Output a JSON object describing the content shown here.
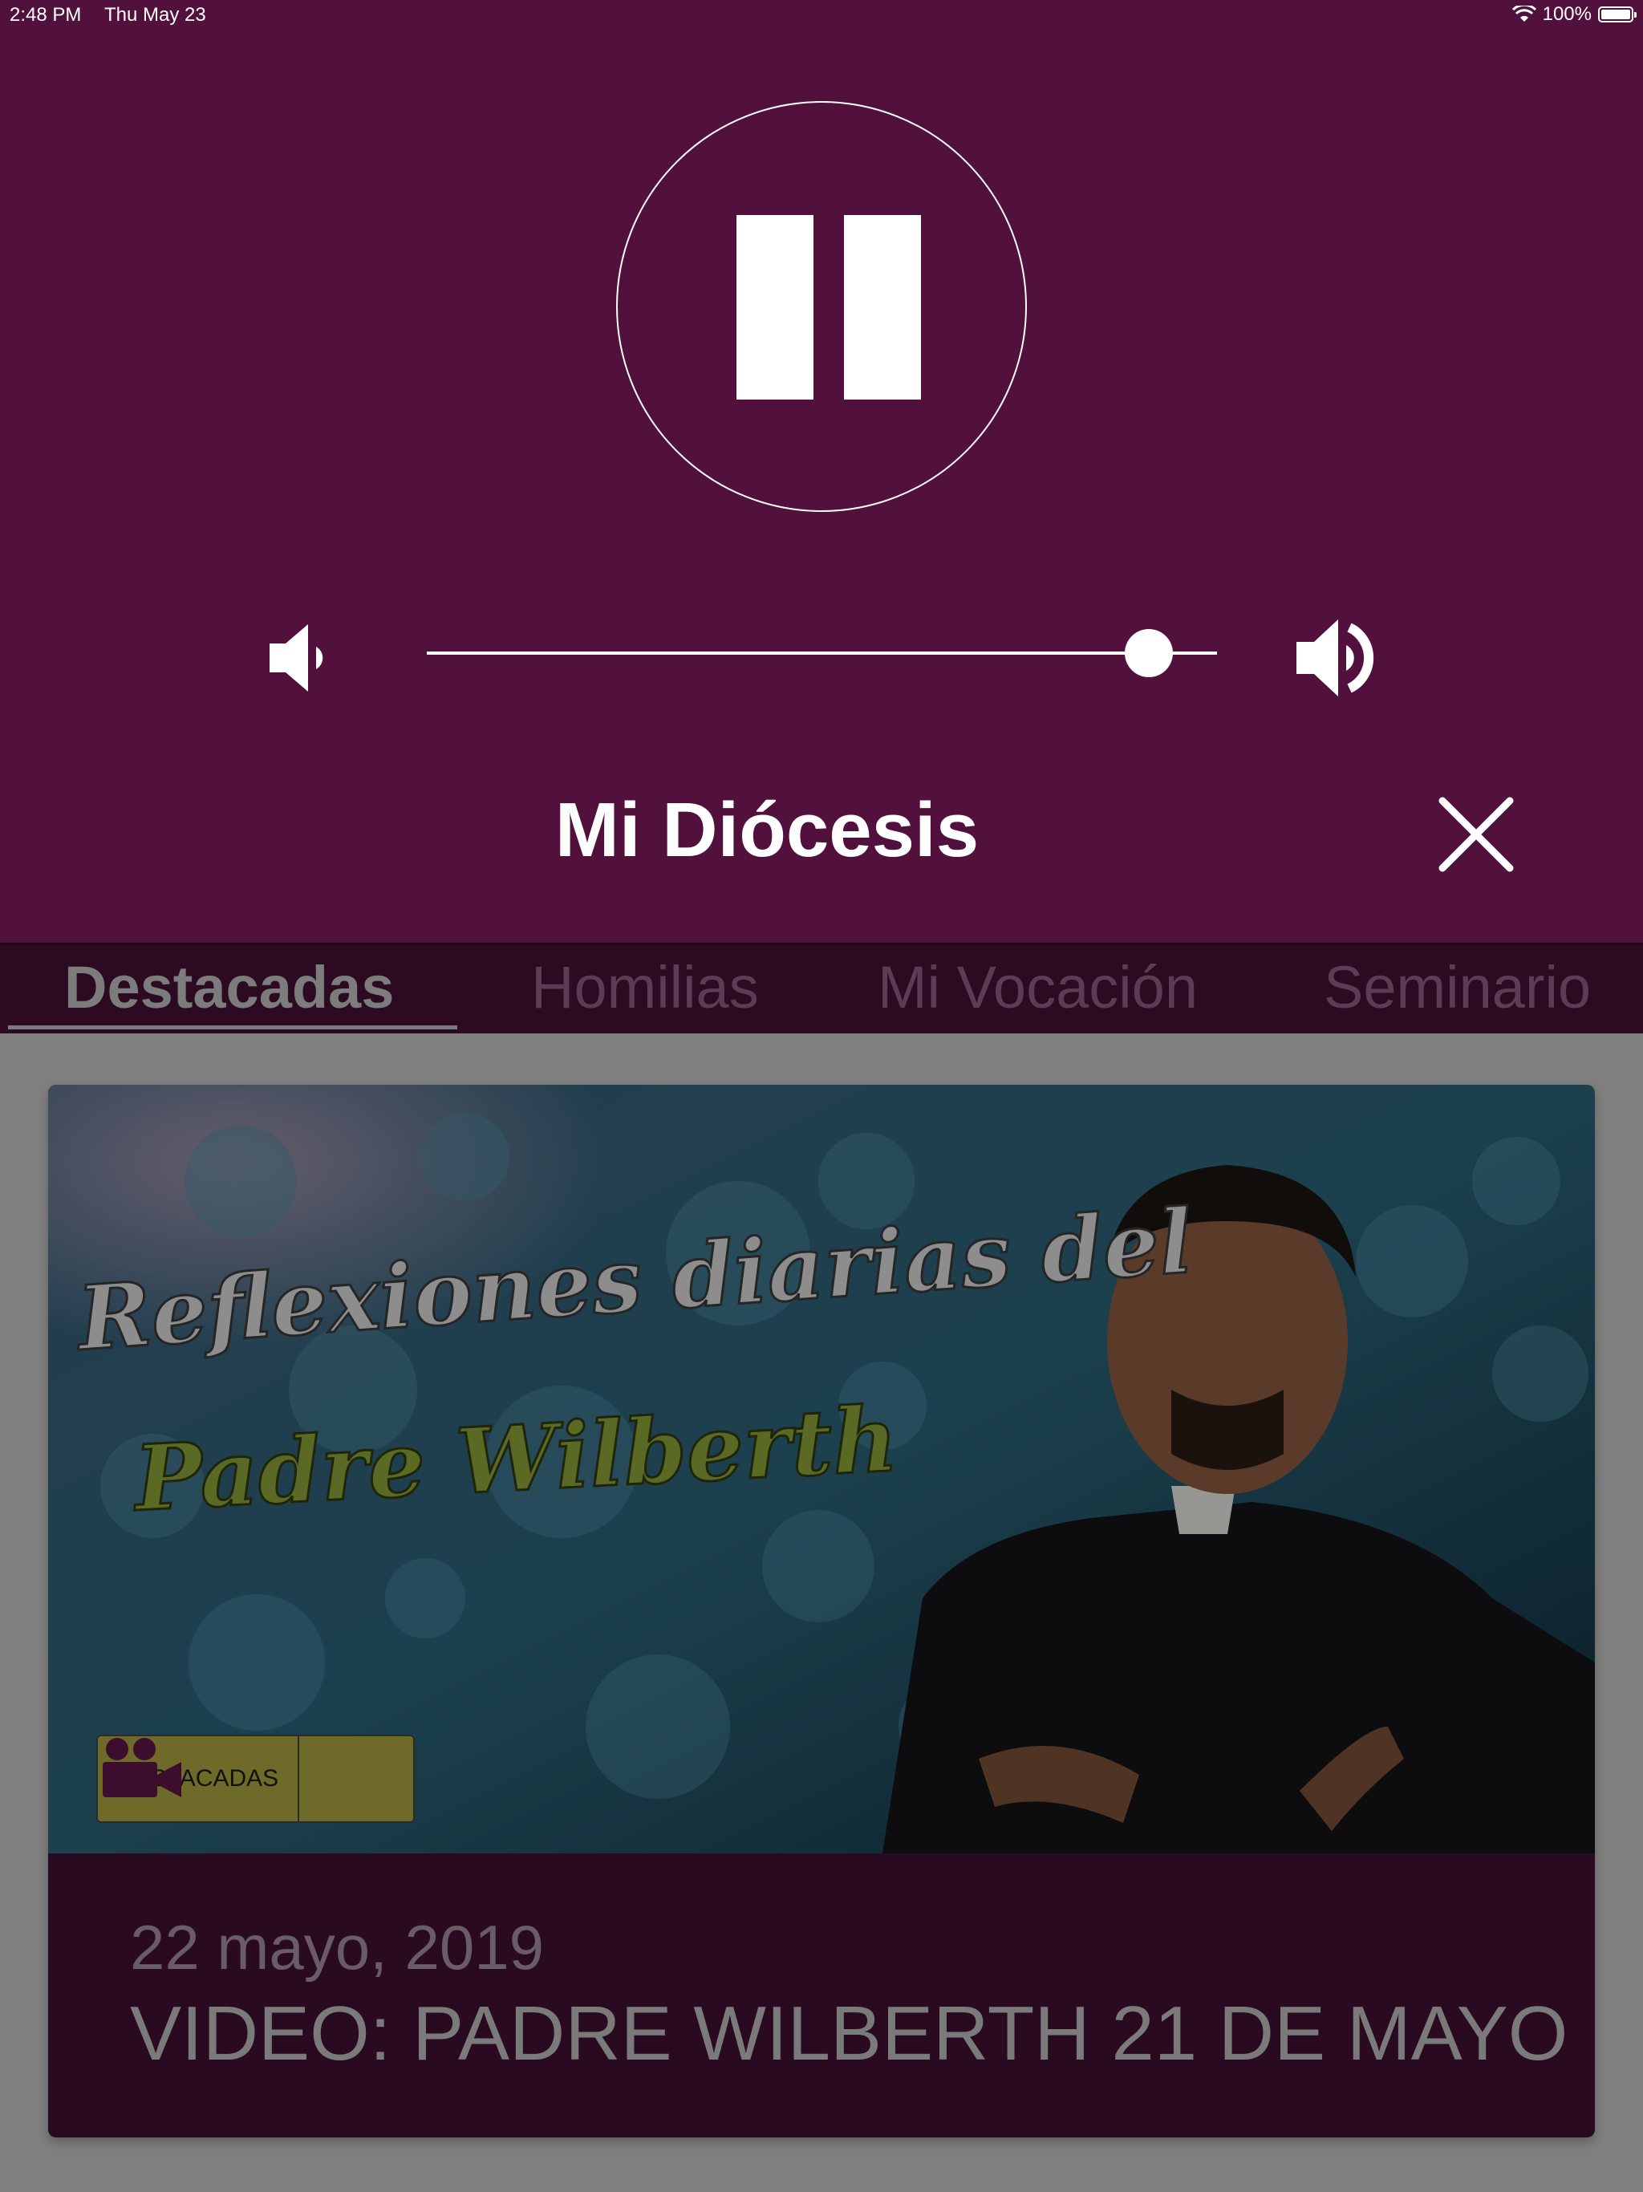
{
  "status_bar": {
    "time": "2:48 PM",
    "date": "Thu May 23",
    "battery": "100%"
  },
  "player": {
    "title": "Mi Diócesis",
    "volume_level": 0.94
  },
  "tabs": [
    {
      "label": "Destacadas",
      "active": true
    },
    {
      "label": "Homilias",
      "active": false
    },
    {
      "label": "Mi Vocación",
      "active": false
    },
    {
      "label": "Seminario",
      "active": false
    }
  ],
  "featured": {
    "badge_label": "DESTACADAS",
    "badge_icon": "video-camera-icon",
    "date": "22 mayo, 2019",
    "title": "VIDEO: PADRE WILBERTH 21 DE MAYO",
    "image_text_line1": "Reflexiones diarias del",
    "image_text_line2": "Padre Wilberth"
  },
  "colors": {
    "player_bg": "#52103c",
    "tabs_bg": "#2c0a22",
    "card_bg": "#2a0a21",
    "overlay_bg": "#7f7f7f"
  }
}
